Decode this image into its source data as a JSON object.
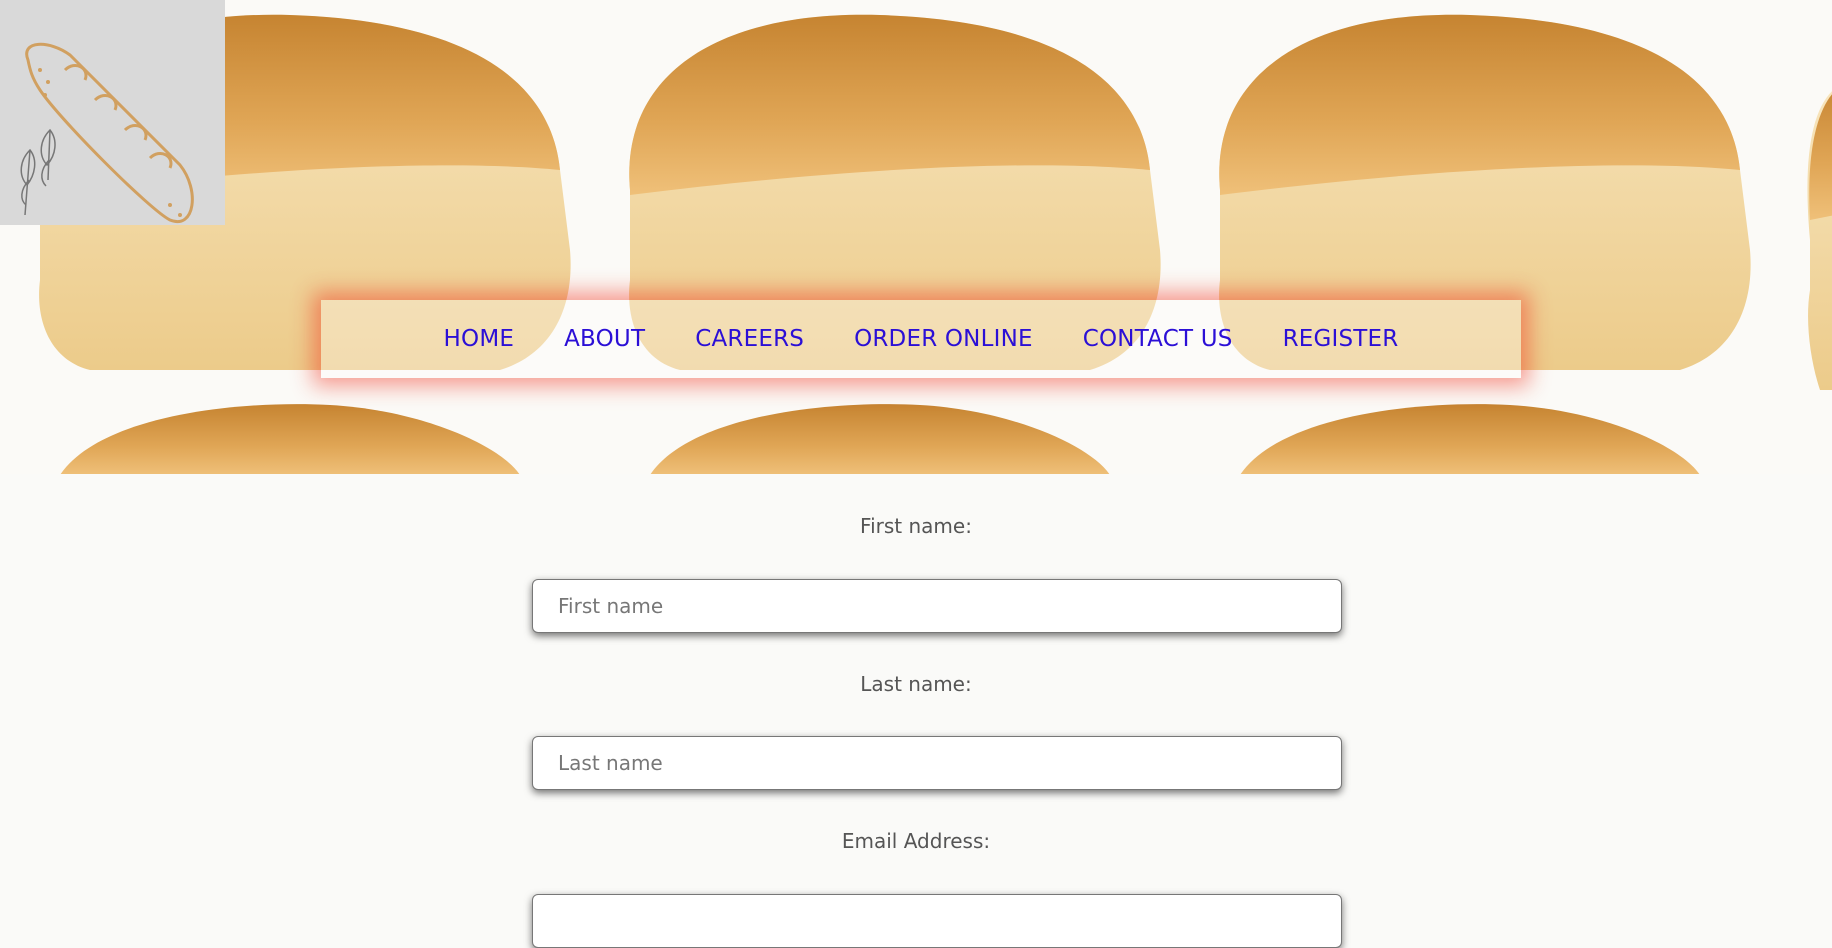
{
  "nav": {
    "items": [
      "HOME",
      "ABOUT",
      "CAREERS",
      "ORDER ONLINE",
      "CONTACT US",
      "REGISTER"
    ]
  },
  "form": {
    "first_name_label": "First name:",
    "first_name_placeholder": "First name",
    "last_name_label": "Last name:",
    "last_name_placeholder": "Last name",
    "email_label": "Email Address:"
  },
  "colors": {
    "nav_link": "#2b0fd6",
    "nav_glow": "#f02814",
    "logo_bg": "#d9d9d9",
    "logo_stroke": "#d1a060",
    "crust": "#c98c3c",
    "crumb": "#f1d9a6"
  },
  "icons": {
    "logo": "baguette-wheat-icon"
  }
}
